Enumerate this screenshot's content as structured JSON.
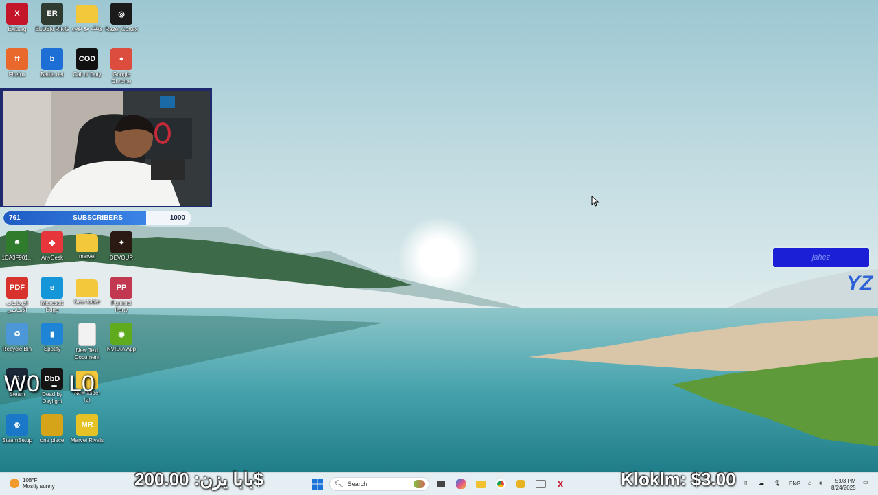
{
  "desktop_icons": [
    {
      "id": "exitlag",
      "label": "ExitLag",
      "col": 0,
      "row": 0,
      "color": "#c4162b",
      "glyph": "X"
    },
    {
      "id": "elden-ring",
      "label": "ELDEN RING",
      "col": 1,
      "row": 0,
      "color": "#2f3a30",
      "glyph": "ER"
    },
    {
      "id": "arabic-folder",
      "label": "وقتك مع نوني",
      "col": 2,
      "row": 0,
      "color": "#f3c83a",
      "glyph": ""
    },
    {
      "id": "razer-cortex",
      "label": "Razer Cortex",
      "col": 3,
      "row": 0,
      "color": "#1b1b1b",
      "glyph": "◎"
    },
    {
      "id": "firefox",
      "label": "Firefox",
      "col": 0,
      "row": 1,
      "color": "#e8692b",
      "glyph": "ff"
    },
    {
      "id": "battlenet",
      "label": "Battle.net",
      "col": 1,
      "row": 1,
      "color": "#1d6fd6",
      "glyph": "b"
    },
    {
      "id": "call-of-duty",
      "label": "Call of Duty",
      "col": 2,
      "row": 1,
      "color": "#111111",
      "glyph": "COD"
    },
    {
      "id": "google-chrome",
      "label": "Google Chrome",
      "col": 3,
      "row": 1,
      "color": "#dd4d3e",
      "glyph": "●"
    },
    {
      "id": "icafe",
      "label": "1CA3F901...",
      "col": 0,
      "row": 5,
      "color": "#2f7d2c",
      "glyph": "☻"
    },
    {
      "id": "anydesk",
      "label": "AnyDesk",
      "col": 1,
      "row": 5,
      "color": "#e6353b",
      "glyph": "◆"
    },
    {
      "id": "marvel-folder",
      "label": "marvel",
      "col": 2,
      "row": 5,
      "color": "#f3c83a",
      "glyph": ""
    },
    {
      "id": "devour",
      "label": "DEVOUR",
      "col": 3,
      "row": 5,
      "color": "#2b1a13",
      "glyph": "✦"
    },
    {
      "id": "pdf-file",
      "label": "الإيجابيات الأساسي",
      "col": 0,
      "row": 6,
      "color": "#d7322b",
      "glyph": "PDF"
    },
    {
      "id": "microsoft-edge",
      "label": "Microsoft Edge",
      "col": 1,
      "row": 6,
      "color": "#1596d8",
      "glyph": "e"
    },
    {
      "id": "new-folder",
      "label": "New folder",
      "col": 2,
      "row": 6,
      "color": "#f3c83a",
      "glyph": ""
    },
    {
      "id": "pummel-party",
      "label": "Pummel Party",
      "col": 3,
      "row": 6,
      "color": "#c23850",
      "glyph": "PP"
    },
    {
      "id": "recycle-bin",
      "label": "Recycle Bin",
      "col": 0,
      "row": 7,
      "color": "#4c97d7",
      "glyph": "♻"
    },
    {
      "id": "spotify",
      "label": "Spotify",
      "col": 1,
      "row": 7,
      "color": "#1f84d6",
      "glyph": "▮"
    },
    {
      "id": "new-text-document",
      "label": "New Text Document",
      "col": 2,
      "row": 7,
      "color": "#f2f2f2",
      "glyph": ""
    },
    {
      "id": "nvidia-app",
      "label": "NVIDIA App",
      "col": 3,
      "row": 7,
      "color": "#5faa1d",
      "glyph": "◉"
    },
    {
      "id": "steam",
      "label": "Steam",
      "col": 0,
      "row": 8,
      "color": "#1b2838",
      "glyph": "S"
    },
    {
      "id": "dead-by-daylight",
      "label": "Dead by Daylight",
      "col": 1,
      "row": 8,
      "color": "#151515",
      "glyph": "DbD"
    },
    {
      "id": "new-folder-2",
      "label": "New folder (2)",
      "col": 2,
      "row": 8,
      "color": "#f3c83a",
      "glyph": ""
    },
    {
      "id": "steam-setup",
      "label": "SteamSetup",
      "col": 0,
      "row": 9,
      "color": "#1b78c8",
      "glyph": "⚙"
    },
    {
      "id": "one-piece",
      "label": "one piece",
      "col": 1,
      "row": 9,
      "color": "#d6a418",
      "glyph": ""
    },
    {
      "id": "marvel-rivals",
      "label": "Marvel Rivals",
      "col": 2,
      "row": 9,
      "color": "#e6c227",
      "glyph": "MR"
    }
  ],
  "overlay": {
    "scoreboard_left": "W0",
    "scoreboard_right": "L0",
    "subscribers_label": "SUBSCRIBERS",
    "subscribers_current": "761",
    "subscribers_goal": "1000",
    "subscribers_progress": 0.761,
    "badge_text": "jahez",
    "brand_mark": "YZ",
    "donation_left": "بابا يزن: 200.00$",
    "donation_right": "Kloklm: $3.00"
  },
  "taskbar": {
    "weather_temp": "108°F",
    "weather_desc": "Mostly sunny",
    "search_placeholder": "Search",
    "language": "ENG",
    "time": "5:03 PM",
    "date": "8/24/2025"
  }
}
